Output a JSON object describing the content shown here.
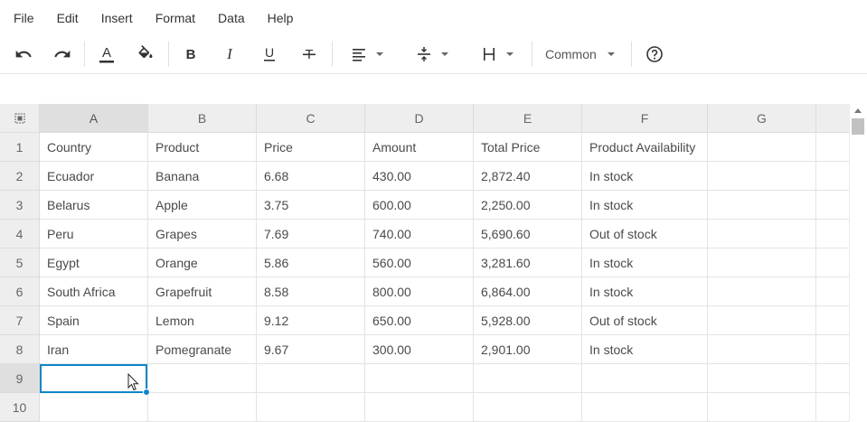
{
  "menu": [
    "File",
    "Edit",
    "Insert",
    "Format",
    "Data",
    "Help"
  ],
  "toolbar": {
    "format_select": "Common",
    "icons": [
      "undo-icon",
      "redo-icon",
      "text-color-icon",
      "fill-color-icon",
      "bold-icon",
      "italic-icon",
      "underline-icon",
      "strikethrough-icon",
      "align-left-icon",
      "vertical-align-icon",
      "text-wrap-icon",
      "help-icon"
    ],
    "text_color_underline": "#333333"
  },
  "columns": [
    "A",
    "B",
    "C",
    "D",
    "E",
    "F",
    "G"
  ],
  "rows": [
    "1",
    "2",
    "3",
    "4",
    "5",
    "6",
    "7",
    "8",
    "9",
    "10"
  ],
  "cells": [
    [
      "Country",
      "Product",
      "Price",
      "Amount",
      "Total Price",
      "Product Availability",
      ""
    ],
    [
      "Ecuador",
      "Banana",
      "6.68",
      "430.00",
      "2,872.40",
      "In stock",
      ""
    ],
    [
      "Belarus",
      "Apple",
      "3.75",
      "600.00",
      "2,250.00",
      "In stock",
      ""
    ],
    [
      "Peru",
      "Grapes",
      "7.69",
      "740.00",
      "5,690.60",
      "Out of stock",
      ""
    ],
    [
      "Egypt",
      "Orange",
      "5.86",
      "560.00",
      "3,281.60",
      "In stock",
      ""
    ],
    [
      "South Africa",
      "Grapefruit",
      "8.58",
      "800.00",
      "6,864.00",
      "In stock",
      ""
    ],
    [
      "Spain",
      "Lemon",
      "9.12",
      "650.00",
      "5,928.00",
      "Out of stock",
      ""
    ],
    [
      "Iran",
      "Pomegranate",
      "9.67",
      "300.00",
      "2,901.00",
      "In stock",
      ""
    ],
    [
      "",
      "",
      "",
      "",
      "",
      "",
      ""
    ],
    [
      "",
      "",
      "",
      "",
      "",
      "",
      ""
    ]
  ],
  "selected_cell": "A9",
  "colors": {
    "accent": "#0e87c7",
    "header_bg": "#eeeeee",
    "selected_header_bg": "#dfdfdf"
  }
}
